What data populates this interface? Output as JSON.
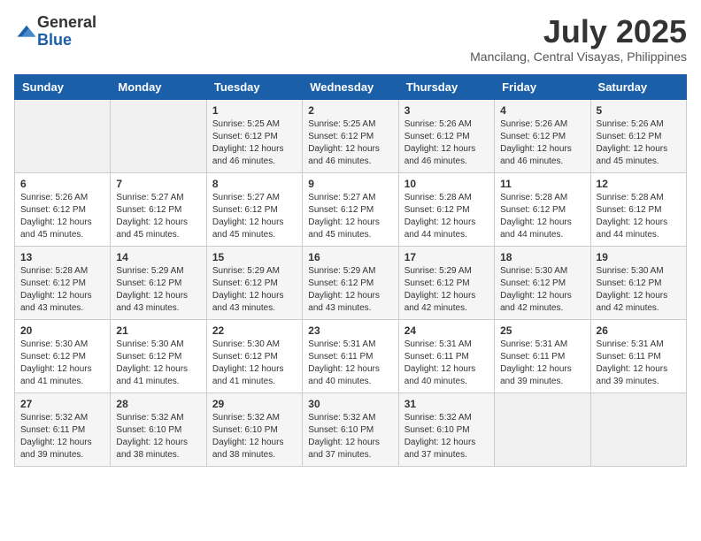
{
  "logo": {
    "general": "General",
    "blue": "Blue"
  },
  "title": {
    "month": "July 2025",
    "location": "Mancilang, Central Visayas, Philippines"
  },
  "days_of_week": [
    "Sunday",
    "Monday",
    "Tuesday",
    "Wednesday",
    "Thursday",
    "Friday",
    "Saturday"
  ],
  "weeks": [
    [
      {
        "day": "",
        "info": ""
      },
      {
        "day": "",
        "info": ""
      },
      {
        "day": "1",
        "info": "Sunrise: 5:25 AM\nSunset: 6:12 PM\nDaylight: 12 hours and 46 minutes."
      },
      {
        "day": "2",
        "info": "Sunrise: 5:25 AM\nSunset: 6:12 PM\nDaylight: 12 hours and 46 minutes."
      },
      {
        "day": "3",
        "info": "Sunrise: 5:26 AM\nSunset: 6:12 PM\nDaylight: 12 hours and 46 minutes."
      },
      {
        "day": "4",
        "info": "Sunrise: 5:26 AM\nSunset: 6:12 PM\nDaylight: 12 hours and 46 minutes."
      },
      {
        "day": "5",
        "info": "Sunrise: 5:26 AM\nSunset: 6:12 PM\nDaylight: 12 hours and 45 minutes."
      }
    ],
    [
      {
        "day": "6",
        "info": "Sunrise: 5:26 AM\nSunset: 6:12 PM\nDaylight: 12 hours and 45 minutes."
      },
      {
        "day": "7",
        "info": "Sunrise: 5:27 AM\nSunset: 6:12 PM\nDaylight: 12 hours and 45 minutes."
      },
      {
        "day": "8",
        "info": "Sunrise: 5:27 AM\nSunset: 6:12 PM\nDaylight: 12 hours and 45 minutes."
      },
      {
        "day": "9",
        "info": "Sunrise: 5:27 AM\nSunset: 6:12 PM\nDaylight: 12 hours and 45 minutes."
      },
      {
        "day": "10",
        "info": "Sunrise: 5:28 AM\nSunset: 6:12 PM\nDaylight: 12 hours and 44 minutes."
      },
      {
        "day": "11",
        "info": "Sunrise: 5:28 AM\nSunset: 6:12 PM\nDaylight: 12 hours and 44 minutes."
      },
      {
        "day": "12",
        "info": "Sunrise: 5:28 AM\nSunset: 6:12 PM\nDaylight: 12 hours and 44 minutes."
      }
    ],
    [
      {
        "day": "13",
        "info": "Sunrise: 5:28 AM\nSunset: 6:12 PM\nDaylight: 12 hours and 43 minutes."
      },
      {
        "day": "14",
        "info": "Sunrise: 5:29 AM\nSunset: 6:12 PM\nDaylight: 12 hours and 43 minutes."
      },
      {
        "day": "15",
        "info": "Sunrise: 5:29 AM\nSunset: 6:12 PM\nDaylight: 12 hours and 43 minutes."
      },
      {
        "day": "16",
        "info": "Sunrise: 5:29 AM\nSunset: 6:12 PM\nDaylight: 12 hours and 43 minutes."
      },
      {
        "day": "17",
        "info": "Sunrise: 5:29 AM\nSunset: 6:12 PM\nDaylight: 12 hours and 42 minutes."
      },
      {
        "day": "18",
        "info": "Sunrise: 5:30 AM\nSunset: 6:12 PM\nDaylight: 12 hours and 42 minutes."
      },
      {
        "day": "19",
        "info": "Sunrise: 5:30 AM\nSunset: 6:12 PM\nDaylight: 12 hours and 42 minutes."
      }
    ],
    [
      {
        "day": "20",
        "info": "Sunrise: 5:30 AM\nSunset: 6:12 PM\nDaylight: 12 hours and 41 minutes."
      },
      {
        "day": "21",
        "info": "Sunrise: 5:30 AM\nSunset: 6:12 PM\nDaylight: 12 hours and 41 minutes."
      },
      {
        "day": "22",
        "info": "Sunrise: 5:30 AM\nSunset: 6:12 PM\nDaylight: 12 hours and 41 minutes."
      },
      {
        "day": "23",
        "info": "Sunrise: 5:31 AM\nSunset: 6:11 PM\nDaylight: 12 hours and 40 minutes."
      },
      {
        "day": "24",
        "info": "Sunrise: 5:31 AM\nSunset: 6:11 PM\nDaylight: 12 hours and 40 minutes."
      },
      {
        "day": "25",
        "info": "Sunrise: 5:31 AM\nSunset: 6:11 PM\nDaylight: 12 hours and 39 minutes."
      },
      {
        "day": "26",
        "info": "Sunrise: 5:31 AM\nSunset: 6:11 PM\nDaylight: 12 hours and 39 minutes."
      }
    ],
    [
      {
        "day": "27",
        "info": "Sunrise: 5:32 AM\nSunset: 6:11 PM\nDaylight: 12 hours and 39 minutes."
      },
      {
        "day": "28",
        "info": "Sunrise: 5:32 AM\nSunset: 6:10 PM\nDaylight: 12 hours and 38 minutes."
      },
      {
        "day": "29",
        "info": "Sunrise: 5:32 AM\nSunset: 6:10 PM\nDaylight: 12 hours and 38 minutes."
      },
      {
        "day": "30",
        "info": "Sunrise: 5:32 AM\nSunset: 6:10 PM\nDaylight: 12 hours and 37 minutes."
      },
      {
        "day": "31",
        "info": "Sunrise: 5:32 AM\nSunset: 6:10 PM\nDaylight: 12 hours and 37 minutes."
      },
      {
        "day": "",
        "info": ""
      },
      {
        "day": "",
        "info": ""
      }
    ]
  ]
}
